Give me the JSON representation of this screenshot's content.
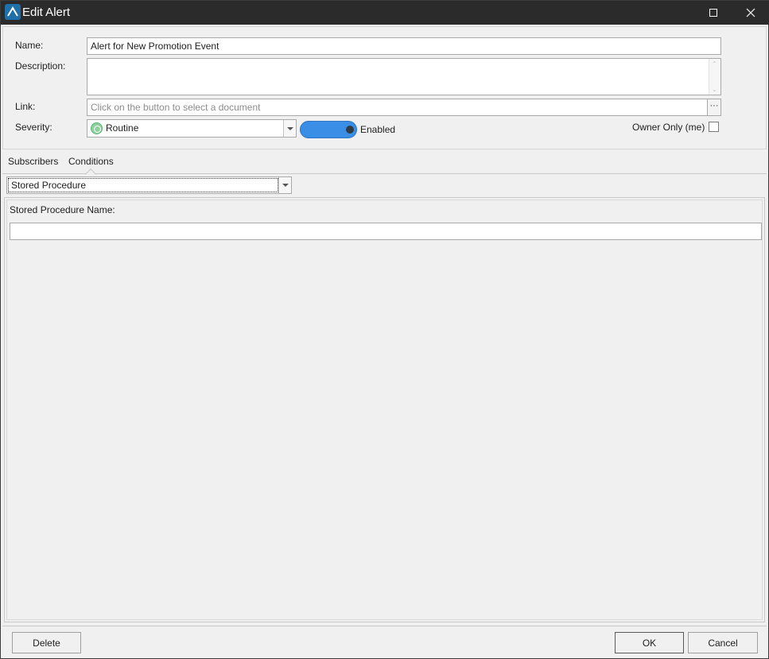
{
  "window": {
    "title": "Edit Alert"
  },
  "form": {
    "name_label": "Name:",
    "name_value": "Alert for New Promotion Event",
    "description_label": "Description:",
    "description_value": "",
    "link_label": "Link:",
    "link_placeholder": "Click on the button to select a document",
    "link_button_label": "···",
    "severity_label": "Severity:",
    "severity_value": "Routine",
    "enabled_label": "Enabled",
    "enabled": true,
    "owner_only_label": "Owner Only (me)",
    "owner_only_checked": false
  },
  "tabs": [
    {
      "label": "Subscribers",
      "active": false
    },
    {
      "label": "Conditions",
      "active": true
    }
  ],
  "conditions": {
    "type_value": "Stored Procedure",
    "stored_procedure_name_label": "Stored Procedure Name:",
    "stored_procedure_name_value": ""
  },
  "footer": {
    "delete_label": "Delete",
    "ok_label": "OK",
    "cancel_label": "Cancel"
  },
  "icons": {
    "app": "app-logo-icon",
    "maximize": "maximize-icon",
    "close": "close-icon",
    "severity": "severity-routine-icon",
    "dropdown": "chevron-down-icon"
  },
  "colors": {
    "titlebar": "#2b2b2b",
    "toggle_on": "#3a8ee6",
    "severity_routine": "#8fd19e"
  }
}
